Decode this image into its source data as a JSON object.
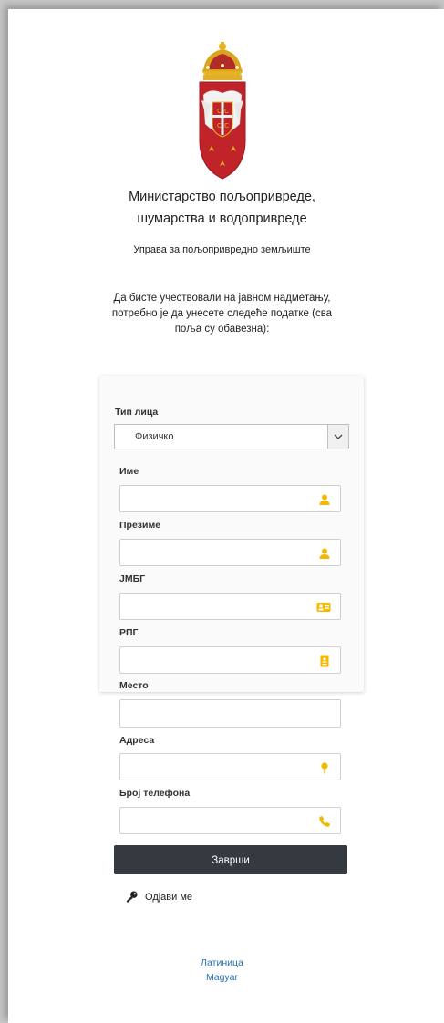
{
  "header": {
    "ministry_line1": "Министарство пољопривреде,",
    "ministry_line2": "шумарства и водопривреде",
    "department": "Управа за пољопривредно земљиште",
    "intro": "Да бисте учествовали на јавном надметању, потребно је да унесете следеће податке (сва поља су обавезна):"
  },
  "form": {
    "type_label": "Тип лица",
    "type_value": "Физичко",
    "first_name_label": "Име",
    "last_name_label": "Презиме",
    "jmbg_label": "ЈМБГ",
    "rpg_label": "РПГ",
    "place_label": "Место",
    "address_label": "Адреса",
    "phone_label": "Број телефона",
    "submit_label": "Заврши",
    "logout_label": "Одјави ме"
  },
  "icons": {
    "person": "user-icon",
    "id_card": "id-card-icon",
    "badge": "badge-icon",
    "location": "map-marker-icon",
    "phone": "phone-icon",
    "key": "key-icon",
    "dropdown": "chevron-down-icon",
    "accent": "#f5b800"
  },
  "footer": {
    "lang_latin": "Латиница",
    "lang_hungarian": "Magyar"
  }
}
